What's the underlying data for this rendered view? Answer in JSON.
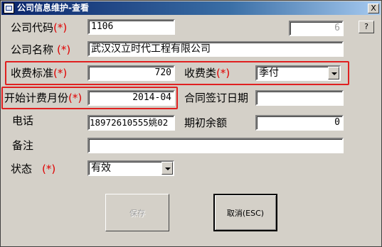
{
  "window": {
    "title": "公司信息维护-查看",
    "close_label": "X",
    "help_label": "?"
  },
  "labels": {
    "company_code": "公司代码",
    "company_name": "公司名称",
    "fee_standard": "收费标准",
    "fee_type": "收费类",
    "start_month": "开始计费月份",
    "contract_date": "合同签订日期",
    "phone": "电话",
    "opening_balance": "期初余额",
    "remark": "备注",
    "status": "状态",
    "required_mark": "(*)"
  },
  "fields": {
    "company_code": "1106",
    "sequence_no": "6",
    "company_name": "武汉汉立时代工程有限公司",
    "fee_standard": "720",
    "fee_type": "季付",
    "start_month": "2014-04",
    "contract_date": "",
    "phone": "18972610555姚02",
    "opening_balance": "0",
    "remark": "",
    "status": "有效"
  },
  "buttons": {
    "save": "保存",
    "cancel": "取消(ESC)"
  },
  "colors": {
    "titlebar_start": "#0a246a",
    "window_bg": "#d4d0c8",
    "required": "#e00000",
    "highlight_box": "#e02020"
  }
}
